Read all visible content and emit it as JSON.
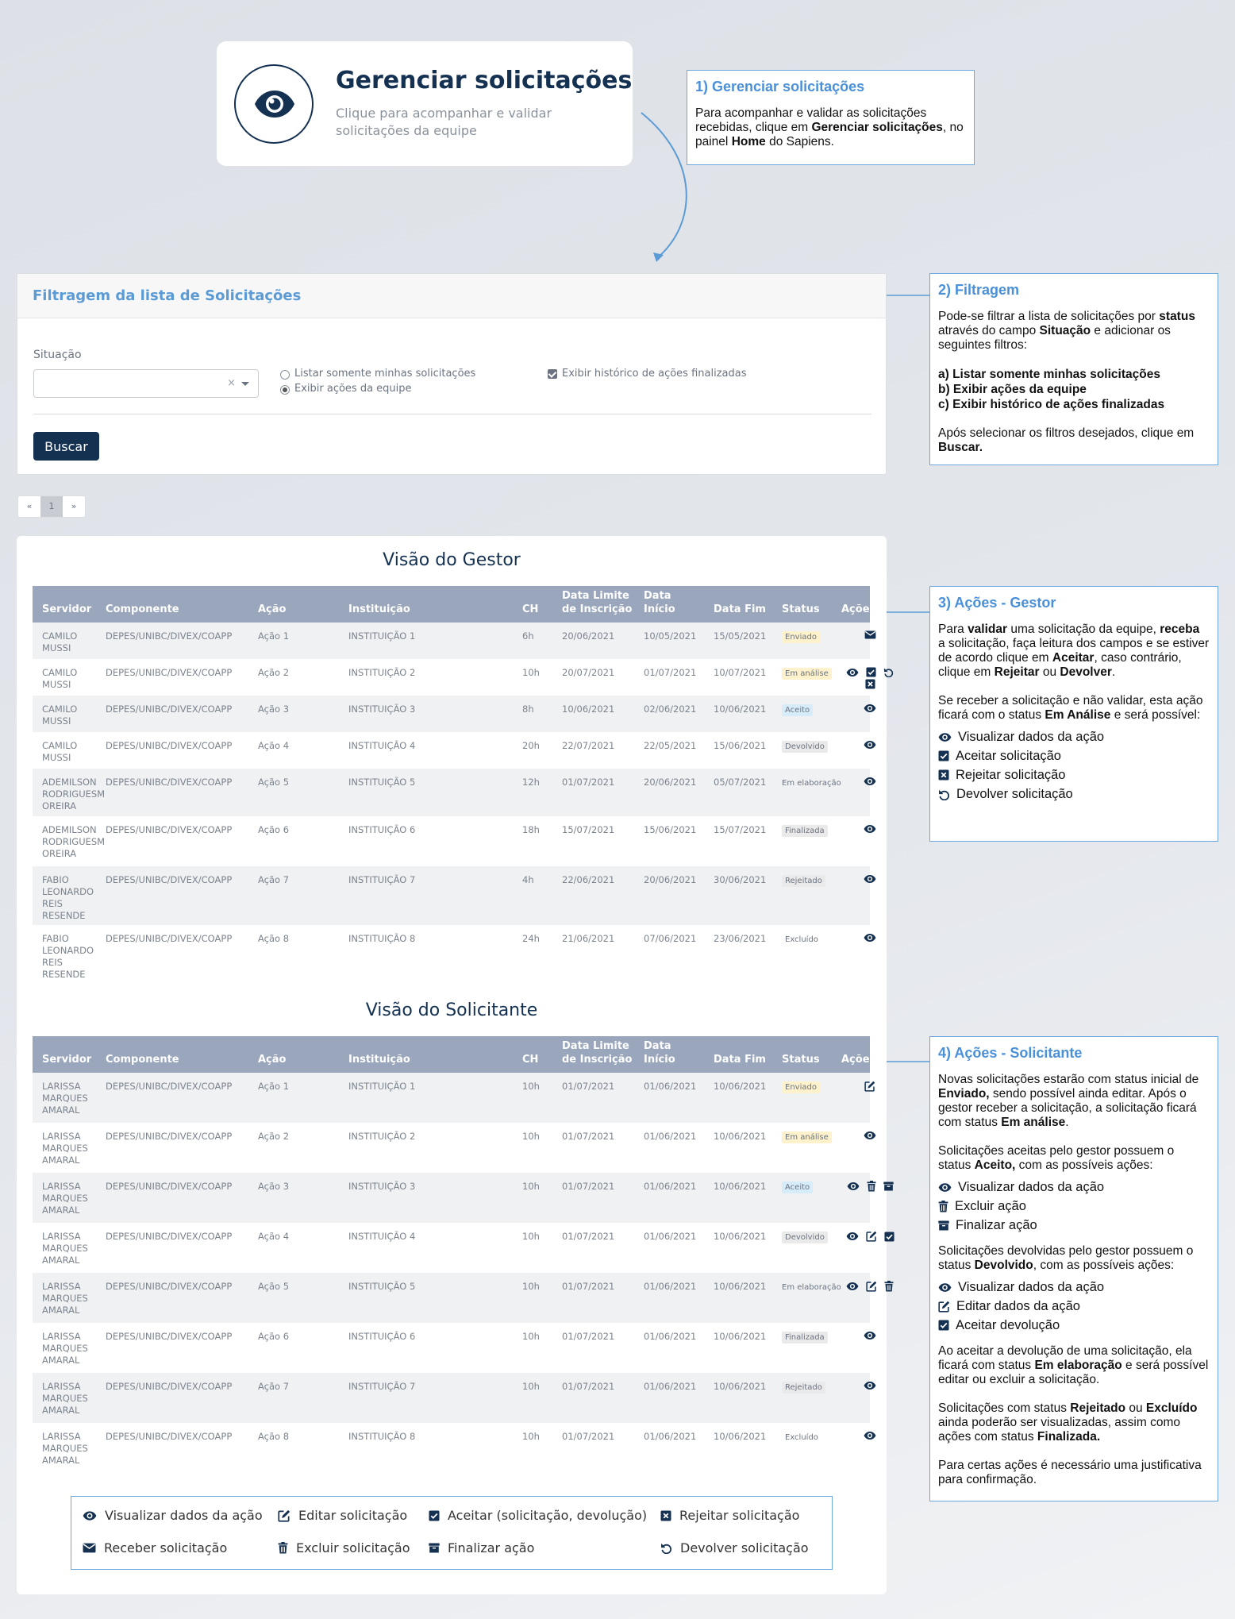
{
  "hero": {
    "title": "Gerenciar solicitações",
    "subtitle": "Clique para acompanhar e validar solicitações da equipe"
  },
  "box1": {
    "title": "1) Gerenciar solicitações",
    "text_a": "Para acompanhar e validar as solicitações recebidas, clique em ",
    "text_b": "Gerenciar solicitações",
    "text_c": ", no painel ",
    "text_d": "Home",
    "text_e": " do Sapiens."
  },
  "box2": {
    "title": "2) Filtragem",
    "p1_a": "Pode-se filtrar a lista de solicitações por ",
    "p1_b": "status",
    "p1_c": " através do campo ",
    "p1_d": "Situação",
    "p1_e": " e adicionar os seguintes filtros:",
    "f_a": "a) Listar somente minhas solicitações",
    "f_b": "b) Exibir ações da equipe",
    "f_c": "c) Exibir histórico de ações finalizadas",
    "p2_a": "Após selecionar os filtros desejados, clique em ",
    "p2_b": "Buscar."
  },
  "box3": {
    "title": "3) Ações - Gestor",
    "p1_a": "Para ",
    "p1_b": "validar",
    "p1_c": " uma solicitação da equipe, ",
    "p1_d": "receba",
    "p1_e": " a solicitação, faça leitura dos campos e se estiver de acordo clique em ",
    "p1_f": "Aceitar",
    "p1_g": ", caso contrário, clique em ",
    "p1_h": "Rejeitar",
    "p1_i": " ou ",
    "p1_j": "Devolver",
    "p1_k": ".",
    "p2_a": "Se receber a solicitação e não validar, esta ação ficará com o status ",
    "p2_b": "Em Análise",
    "p2_c": " e será possível:",
    "items": [
      "Visualizar dados da ação",
      "Aceitar solicitação",
      "Rejeitar solicitação",
      "Devolver solicitação"
    ]
  },
  "box4": {
    "title": "4) Ações - Solicitante",
    "p1_a": "Novas solicitações estarão com status inicial de ",
    "p1_b": "Enviado,",
    "p1_c": " sendo possível ainda editar. Após o gestor receber a solicitação, a solicitação ficará com status ",
    "p1_d": "Em análise",
    "p1_e": ".",
    "p2_a": "Solicitações aceitas pelo gestor possuem o status ",
    "p2_b": "Aceito,",
    "p2_c": " com as possíveis ações:",
    "list1": [
      "Visualizar dados da ação",
      "Excluir ação",
      "Finalizar ação"
    ],
    "p3_a": "Solicitações devolvidas pelo gestor possuem o status ",
    "p3_b": "Devolvido",
    "p3_c": ", com as possíveis ações:",
    "list2": [
      "Visualizar dados da ação",
      "Editar dados da ação",
      "Aceitar devolução"
    ],
    "p4_a": "Ao aceitar a devolução de uma solicitação, ela ficará com status ",
    "p4_b": "Em elaboração",
    "p4_c": " e será possível editar ou excluir a solicitação.",
    "p5_a": "Solicitações com status ",
    "p5_b": "Rejeitado",
    "p5_c": " ou ",
    "p5_d": "Excluído",
    "p5_e": " ainda poderão ser visualizadas, assim como ações com status ",
    "p5_f": "Finalizada.",
    "p6": "Para certas ações é necessário uma justificativa para confirmação."
  },
  "filter": {
    "title": "Filtragem da lista de Solicitações",
    "situacao_label": "Situação",
    "clear": "×",
    "opt_minhas": "Listar somente minhas solicitações",
    "opt_equipe": "Exibir ações da equipe",
    "opt_historico": "Exibir histórico de ações finalizadas",
    "buscar": "Buscar"
  },
  "pager": {
    "prev": "«",
    "page": "1",
    "next": "»"
  },
  "columns": [
    "Servidor",
    "Componente",
    "Ação",
    "Instituição",
    "CH",
    "Data Limite de Inscrição",
    "Data Início",
    "Data Fim",
    "Status",
    "Ações"
  ],
  "gestor": {
    "title": "Visão do Gestor",
    "rows": [
      {
        "servidor": "CAMILO MUSSI",
        "componente": "DEPES/UNIBC/DIVEX/COAPP",
        "acao": "Ação 1",
        "instituicao": "INSTITUIÇÃO 1",
        "ch": "6h",
        "limite": "20/06/2021",
        "inicio": "10/05/2021",
        "fim": "15/05/2021",
        "status": "Enviado",
        "icons": [
          "envelope-icon"
        ]
      },
      {
        "servidor": "CAMILO MUSSI",
        "componente": "DEPES/UNIBC/DIVEX/COAPP",
        "acao": "Ação 2",
        "instituicao": "INSTITUIÇÃO 2",
        "ch": "10h",
        "limite": "20/07/2021",
        "inicio": "01/07/2021",
        "fim": "10/07/2021",
        "status": "Em análise",
        "icons": [
          "eye-icon",
          "check-square-icon",
          "undo-icon",
          "x-square-icon"
        ]
      },
      {
        "servidor": "CAMILO MUSSI",
        "componente": "DEPES/UNIBC/DIVEX/COAPP",
        "acao": "Ação 3",
        "instituicao": "INSTITUIÇÃO 3",
        "ch": "8h",
        "limite": "10/06/2021",
        "inicio": "02/06/2021",
        "fim": "10/06/2021",
        "status": "Aceito",
        "icons": [
          "eye-icon"
        ]
      },
      {
        "servidor": "CAMILO MUSSI",
        "componente": "DEPES/UNIBC/DIVEX/COAPP",
        "acao": "Ação 4",
        "instituicao": "INSTITUIÇÃO 4",
        "ch": "20h",
        "limite": "22/07/2021",
        "inicio": "22/05/2021",
        "fim": "15/06/2021",
        "status": "Devolvido",
        "icons": [
          "eye-icon"
        ]
      },
      {
        "servidor": "ADEMILSON RODRIGUESM OREIRA",
        "componente": "DEPES/UNIBC/DIVEX/COAPP",
        "acao": "Ação 5",
        "instituicao": "INSTITUIÇÃO 5",
        "ch": "12h",
        "limite": "01/07/2021",
        "inicio": "20/06/2021",
        "fim": "05/07/2021",
        "status": "Em elaboração",
        "icons": [
          "eye-icon"
        ]
      },
      {
        "servidor": "ADEMILSON RODRIGUESM OREIRA",
        "componente": "DEPES/UNIBC/DIVEX/COAPP",
        "acao": "Ação 6",
        "instituicao": "INSTITUIÇÃO 6",
        "ch": "18h",
        "limite": "15/07/2021",
        "inicio": "15/06/2021",
        "fim": "15/07/2021",
        "status": "Finalizada",
        "icons": [
          "eye-icon"
        ]
      },
      {
        "servidor": "FABIO LEONARDO REIS RESENDE",
        "componente": "DEPES/UNIBC/DIVEX/COAPP",
        "acao": "Ação 7",
        "instituicao": "INSTITUIÇÃO 7",
        "ch": "4h",
        "limite": "22/06/2021",
        "inicio": "20/06/2021",
        "fim": "30/06/2021",
        "status": "Rejeitado",
        "icons": [
          "eye-icon"
        ]
      },
      {
        "servidor": "FABIO LEONARDO REIS RESENDE",
        "componente": "DEPES/UNIBC/DIVEX/COAPP",
        "acao": "Ação 8",
        "instituicao": "INSTITUIÇÃO 8",
        "ch": "24h",
        "limite": "21/06/2021",
        "inicio": "07/06/2021",
        "fim": "23/06/2021",
        "status": "Excluído",
        "icons": [
          "eye-icon"
        ]
      }
    ]
  },
  "solicitante": {
    "title": "Visão do Solicitante",
    "rows": [
      {
        "servidor": "LARISSA MARQUES AMARAL",
        "componente": "DEPES/UNIBC/DIVEX/COAPP",
        "acao": "Ação 1",
        "instituicao": "INSTITUIÇÃO 1",
        "ch": "10h",
        "limite": "01/07/2021",
        "inicio": "01/06/2021",
        "fim": "10/06/2021",
        "status": "Enviado",
        "icons": [
          "edit-icon"
        ]
      },
      {
        "servidor": "LARISSA MARQUES AMARAL",
        "componente": "DEPES/UNIBC/DIVEX/COAPP",
        "acao": "Ação 2",
        "instituicao": "INSTITUIÇÃO 2",
        "ch": "10h",
        "limite": "01/07/2021",
        "inicio": "01/06/2021",
        "fim": "10/06/2021",
        "status": "Em análise",
        "icons": [
          "eye-icon"
        ]
      },
      {
        "servidor": "LARISSA MARQUES AMARAL",
        "componente": "DEPES/UNIBC/DIVEX/COAPP",
        "acao": "Ação 3",
        "instituicao": "INSTITUIÇÃO 3",
        "ch": "10h",
        "limite": "01/07/2021",
        "inicio": "01/06/2021",
        "fim": "10/06/2021",
        "status": "Aceito",
        "icons": [
          "eye-icon",
          "trash-icon",
          "archive-icon"
        ]
      },
      {
        "servidor": "LARISSA MARQUES AMARAL",
        "componente": "DEPES/UNIBC/DIVEX/COAPP",
        "acao": "Ação 4",
        "instituicao": "INSTITUIÇÃO 4",
        "ch": "10h",
        "limite": "01/07/2021",
        "inicio": "01/06/2021",
        "fim": "10/06/2021",
        "status": "Devolvido",
        "icons": [
          "eye-icon",
          "edit-icon",
          "check-square-icon"
        ]
      },
      {
        "servidor": "LARISSA MARQUES AMARAL",
        "componente": "DEPES/UNIBC/DIVEX/COAPP",
        "acao": "Ação 5",
        "instituicao": "INSTITUIÇÃO 5",
        "ch": "10h",
        "limite": "01/07/2021",
        "inicio": "01/06/2021",
        "fim": "10/06/2021",
        "status": "Em elaboração",
        "icons": [
          "eye-icon",
          "edit-icon",
          "trash-icon"
        ]
      },
      {
        "servidor": "LARISSA MARQUES AMARAL",
        "componente": "DEPES/UNIBC/DIVEX/COAPP",
        "acao": "Ação 6",
        "instituicao": "INSTITUIÇÃO 6",
        "ch": "10h",
        "limite": "01/07/2021",
        "inicio": "01/06/2021",
        "fim": "10/06/2021",
        "status": "Finalizada",
        "icons": [
          "eye-icon"
        ]
      },
      {
        "servidor": "LARISSA MARQUES AMARAL",
        "componente": "DEPES/UNIBC/DIVEX/COAPP",
        "acao": "Ação 7",
        "instituicao": "INSTITUIÇÃO 7",
        "ch": "10h",
        "limite": "01/07/2021",
        "inicio": "01/06/2021",
        "fim": "10/06/2021",
        "status": "Rejeitado",
        "icons": [
          "eye-icon"
        ]
      },
      {
        "servidor": "LARISSA MARQUES AMARAL",
        "componente": "DEPES/UNIBC/DIVEX/COAPP",
        "acao": "Ação 8",
        "instituicao": " INSTITUIÇÃO 8",
        "ch": "10h",
        "limite": "01/07/2021",
        "inicio": "01/06/2021",
        "fim": "10/06/2021",
        "status": "Excluído",
        "icons": [
          "eye-icon"
        ]
      }
    ]
  },
  "legend": {
    "visualizar": "Visualizar dados da ação",
    "editar": "Editar solicitação",
    "aceitar": "Aceitar (solicitação, devolução)",
    "rejeitar": "Rejeitar solicitação",
    "receber": "Receber solicitação",
    "excluir": "Excluir solicitação",
    "finalizar": "Finalizar ação",
    "devolver": "Devolver solicitação"
  },
  "colors": {
    "navy": "#143152",
    "accent_blue": "#4a90d9",
    "table_header": "#99a6bb"
  }
}
